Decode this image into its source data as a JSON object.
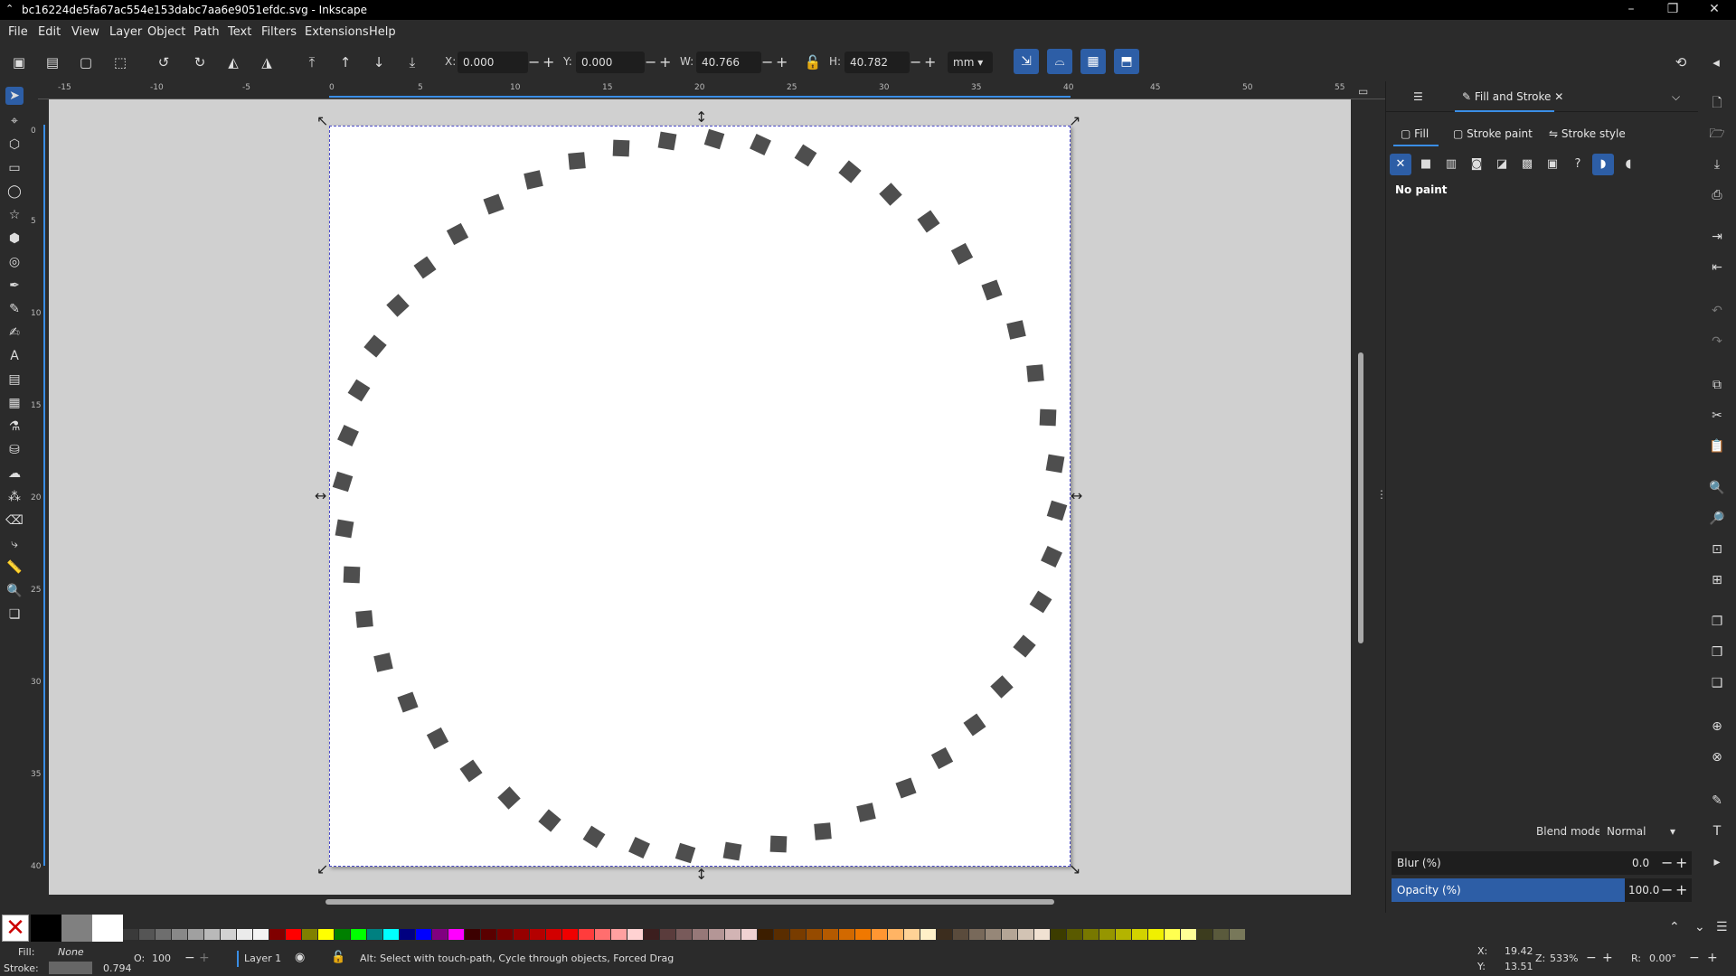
{
  "window": {
    "title": "bc16224de5fa67ac554e153dabc7aa6e9051efdc.svg - Inkscape"
  },
  "menu": [
    "File",
    "Edit",
    "View",
    "Layer",
    "Object",
    "Path",
    "Text",
    "Filters",
    "Extensions",
    "Help"
  ],
  "toolbar": {
    "x_label": "X:",
    "x_value": "0.000",
    "y_label": "Y:",
    "y_value": "0.000",
    "w_label": "W:",
    "w_value": "40.766",
    "h_label": "H:",
    "h_value": "40.782",
    "unit": "mm"
  },
  "ruler": {
    "h_ticks": [
      "-15",
      "-10",
      "-5",
      "0",
      "5",
      "10",
      "15",
      "20",
      "25",
      "30",
      "35",
      "40",
      "45",
      "50",
      "55"
    ],
    "v_ticks": [
      "0",
      "5",
      "10",
      "15",
      "20",
      "25",
      "30",
      "35",
      "40"
    ]
  },
  "dock": {
    "tab_label": "Fill and Stroke",
    "fill_tab": "Fill",
    "stroke_paint_tab": "Stroke paint",
    "stroke_style_tab": "Stroke style",
    "paint_status": "No paint",
    "blend_label": "Blend mode:",
    "blend_value": "Normal",
    "blur_label": "Blur (%)",
    "blur_value": "0.0",
    "opacity_label": "Opacity (%)",
    "opacity_value": "100.0"
  },
  "status": {
    "fill_label": "Fill:",
    "fill_value": "None",
    "stroke_label": "Stroke:",
    "stroke_width": "0.794",
    "opacity_label": "O:",
    "opacity_value": "100",
    "layer": "Layer 1",
    "message": "Alt: Select with touch-path, Cycle through objects, Forced Drag",
    "x_label": "X:",
    "x_value": "19.42",
    "y_label": "Y:",
    "y_value": "13.51",
    "zoom_label": "Z:",
    "zoom_value": "533%",
    "rot_label": "R:",
    "rot_value": "0.00°"
  },
  "colors": {
    "accent": "#2d5ea6",
    "dot": "#4e4e4e",
    "palette": [
      "#000000",
      "#808080",
      "#ffffff",
      "#3a3a3a",
      "#555555",
      "#6e6e6e",
      "#888888",
      "#a0a0a0",
      "#b9b9b9",
      "#d2d2d2",
      "#ebebeb",
      "#f4f4f4",
      "#800000",
      "#ff0000",
      "#808000",
      "#ffff00",
      "#008000",
      "#00ff00",
      "#008080",
      "#00ffff",
      "#000080",
      "#0000ff",
      "#800080",
      "#ff00ff",
      "#3c0000",
      "#5a0000",
      "#780000",
      "#960000",
      "#b40000",
      "#d20000",
      "#f00000",
      "#ff3c3c",
      "#ff6e6e",
      "#ffa0a0",
      "#ffd2d2",
      "#3c1e1e",
      "#5a3c3c",
      "#785a5a",
      "#967878",
      "#b49696",
      "#d2b4b4",
      "#f0d2d2",
      "#3c1e00",
      "#5a2d00",
      "#783c00",
      "#964b00",
      "#b45a00",
      "#d26900",
      "#f07800",
      "#ff9632",
      "#ffb464",
      "#ffd296",
      "#fff0c8",
      "#3c2d1e",
      "#5a4b3c",
      "#78695a",
      "#968778",
      "#b4a596",
      "#d2c3b4",
      "#f0e1d2",
      "#3c3c00",
      "#5a5a00",
      "#787800",
      "#969600",
      "#b4b400",
      "#d2d200",
      "#f0f000",
      "#ffff50",
      "#ffff96",
      "#3c3c1e",
      "#5a5a3c",
      "#78785a"
    ]
  }
}
